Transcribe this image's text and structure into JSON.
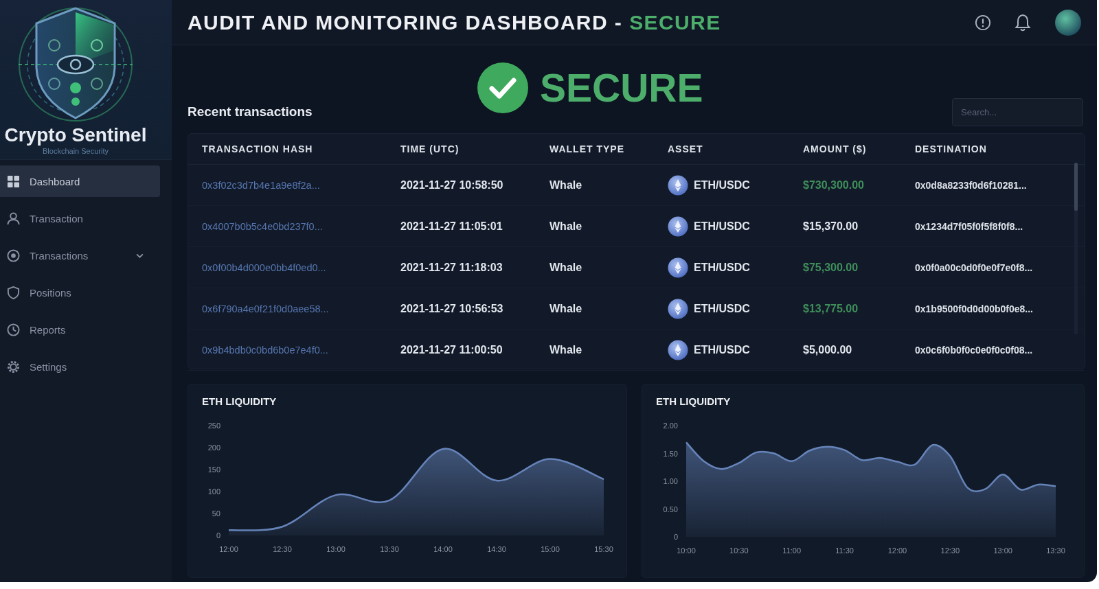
{
  "sidebar": {
    "brand": {
      "name": "Crypto Sentinel",
      "tagline": "Blockchain Security"
    },
    "items": [
      {
        "label": "Dashboard",
        "kind": "link",
        "selected": true
      },
      {
        "label": "Transaction",
        "kind": "link",
        "selected": false
      },
      {
        "label": "Transactions",
        "kind": "group",
        "selected": false
      },
      {
        "label": "Positions",
        "kind": "link",
        "selected": false
      },
      {
        "label": "Reports",
        "kind": "link",
        "selected": false
      },
      {
        "label": "Settings",
        "kind": "link",
        "selected": false
      }
    ]
  },
  "header": {
    "title": "AUDIT AND MONITORING DASHBOARD -",
    "status": "SECURE"
  },
  "status_banner": {
    "kind": "secure",
    "label": "SECURE"
  },
  "transactions": {
    "title": "Recent transactions",
    "search": {
      "placeholder": "Search..."
    },
    "columns": [
      "TRANSACTION HASH",
      "TIME (UTC)",
      "WALLET TYPE",
      "ASSET",
      "AMOUNT ($)",
      "DESTINATION"
    ],
    "rows": [
      {
        "hash": "0x3f02c3d7b4e1a9e8f2a...",
        "time": "2021-11-27 10:58:50",
        "wallet_type": "Whale",
        "asset": "ETH/USDC",
        "amount": "$730,300.00",
        "color": "#3f8f5a",
        "destination": "0x0d8a8233f0d6f10281..."
      },
      {
        "hash": "0x4007b0b5c4e0bd237f0...",
        "time": "2021-11-27 11:05:01",
        "wallet_type": "Whale",
        "asset": "ETH/USDC",
        "amount": "$15,370.00",
        "color": "#e3e7ee",
        "destination": "0x1234d7f05f0f5f8f0f8..."
      },
      {
        "hash": "0x0f00b4d000e0bb4f0ed0...",
        "time": "2021-11-27 11:18:03",
        "wallet_type": "Whale",
        "asset": "ETH/USDC",
        "amount": "$75,300.00",
        "color": "#3f8f5a",
        "destination": "0x0f0a00c0d0f0e0f7e0f8..."
      },
      {
        "hash": "0x6f790a4e0f21f0d0aee58...",
        "time": "2021-11-27 10:56:53",
        "wallet_type": "Whale",
        "asset": "ETH/USDC",
        "amount": "$13,775.00",
        "color": "#3f8f5a",
        "destination": "0x1b9500f0d0d00b0f0e8..."
      },
      {
        "hash": "0x9b4bdb0c0bd6b0e7e4f0...",
        "time": "2021-11-27 11:00:50",
        "wallet_type": "Whale",
        "asset": "ETH/USDC",
        "amount": "$5,000.00",
        "color": "#e3e7ee",
        "destination": "0x0c6f0b0f0c0e0f0c0f08..."
      }
    ]
  },
  "charts": [
    {
      "chart_data": {
        "type": "area",
        "title": "ETH LIQUIDITY",
        "categories": [
          "12:00",
          "12:30",
          "13:00",
          "13:30",
          "14:00",
          "14:30",
          "15:00",
          "15:30"
        ],
        "values": [
          12,
          20,
          92,
          80,
          197,
          125,
          174,
          128
        ],
        "color": "#6684ba",
        "ylim": [
          0,
          250
        ],
        "yticks": [
          0,
          50,
          100,
          150,
          200,
          250
        ]
      }
    },
    {
      "chart_data": {
        "type": "area",
        "title": "ETH LIQUIDITY",
        "categories": [
          "10:00",
          null,
          null,
          "10:30",
          null,
          null,
          "11:00",
          null,
          null,
          "11:30",
          null,
          null,
          "12:00",
          null,
          null,
          "12:30",
          null,
          null,
          "13:00",
          null,
          null,
          "13:30"
        ],
        "values": [
          1.7,
          1.36,
          1.22,
          1.33,
          1.52,
          1.5,
          1.36,
          1.55,
          1.62,
          1.56,
          1.38,
          1.42,
          1.35,
          1.3,
          1.65,
          1.45,
          0.88,
          0.86,
          1.12,
          0.85,
          0.94,
          0.91
        ],
        "color": "#6684ba",
        "ylim": [
          0,
          2
        ],
        "yticks": [
          0,
          {
            "value": 0.5,
            "label": "0.50"
          },
          {
            "value": 1,
            "label": "1.00"
          },
          {
            "value": 1.5,
            "label": "1.50"
          },
          {
            "value": 2,
            "label": "2.00"
          }
        ]
      }
    }
  ]
}
